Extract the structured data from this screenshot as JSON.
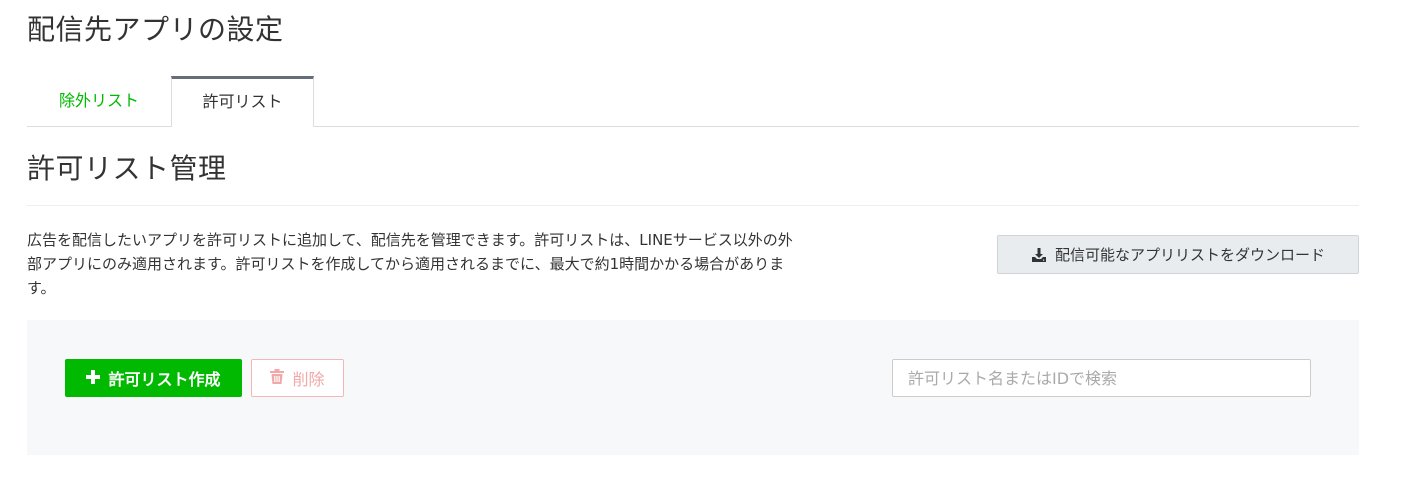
{
  "page": {
    "title": "配信先アプリの設定"
  },
  "tabs": [
    {
      "label": "除外リスト",
      "active": false
    },
    {
      "label": "許可リスト",
      "active": true
    }
  ],
  "section": {
    "title": "許可リスト管理",
    "description": "広告を配信したいアプリを許可リストに追加して、配信先を管理できます。許可リストは、LINEサービス以外の外部アプリにのみ適用されます。許可リストを作成してから適用されるまでに、最大で約1時間かかる場合があります。"
  },
  "download_button": {
    "label": "配信可能なアプリリストをダウンロード",
    "icon": "download-icon"
  },
  "toolbar": {
    "create_label": "許可リスト作成",
    "create_icon": "plus-icon",
    "delete_label": "削除",
    "delete_icon": "trash-icon",
    "delete_disabled": true,
    "search_placeholder": "許可リスト名またはIDで検索",
    "search_value": ""
  },
  "colors": {
    "accent": "#00b900",
    "active_tab_border": "#676c7a",
    "panel_bg": "#f7f8f9",
    "delete_disabled": "#f0a8a8"
  }
}
